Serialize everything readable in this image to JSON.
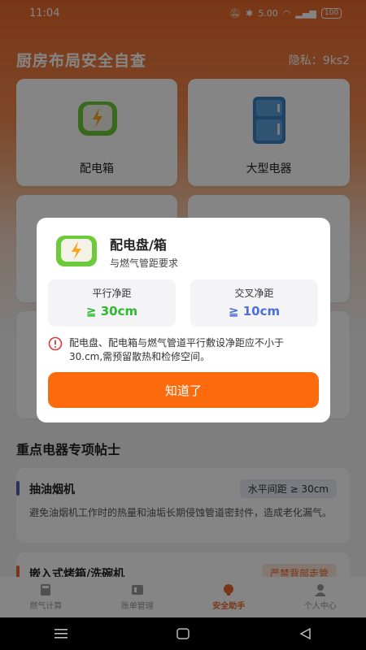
{
  "status_bar": {
    "time": "11:04",
    "network_speed": "5.00",
    "battery": "100"
  },
  "header": {
    "title": "厨房布局安全自查",
    "privacy": "隐私：9ks2"
  },
  "cards": [
    {
      "label": "配电箱",
      "icon": "electric-box-icon"
    },
    {
      "label": "大型电器",
      "icon": "fridge-icon"
    }
  ],
  "section": {
    "title": "重点电器专项帖士"
  },
  "tips": [
    {
      "name": "抽油烟机",
      "tag": "水平间距 ≥ 30cm",
      "desc": "避免油烟机工作时的热量和油垢长期侵蚀管道密封件，造成老化漏气。",
      "accent": "#5561a8"
    },
    {
      "name": "嵌入式烤箱/洗碗机",
      "tag": "严禁背部走管",
      "desc": "",
      "accent": "#e8692b"
    }
  ],
  "tabbar": {
    "tabs": [
      {
        "label": "燃气计算",
        "icon": "calculator-icon"
      },
      {
        "label": "账单管理",
        "icon": "bill-icon"
      },
      {
        "label": "安全助手",
        "icon": "bulb-icon"
      },
      {
        "label": "个人中心",
        "icon": "person-icon"
      }
    ],
    "active_index": 2
  },
  "modal": {
    "title": "配电盘/箱",
    "subtitle": "与燃气管距要求",
    "parallel": {
      "label": "平行净距",
      "value": "≧ 30cm"
    },
    "cross": {
      "label": "交叉净距",
      "value": "≧ 10cm"
    },
    "warning": "配电盘、配电箱与燃气管道平行敷设净距应不小于30.cm,需预留散热和检修空间。",
    "button": "知道了"
  },
  "colors": {
    "brand": "#e8692b",
    "button": "#fb6b0e",
    "green": "#2fb82f",
    "blue": "#4b6fdc",
    "red": "#e03838"
  }
}
